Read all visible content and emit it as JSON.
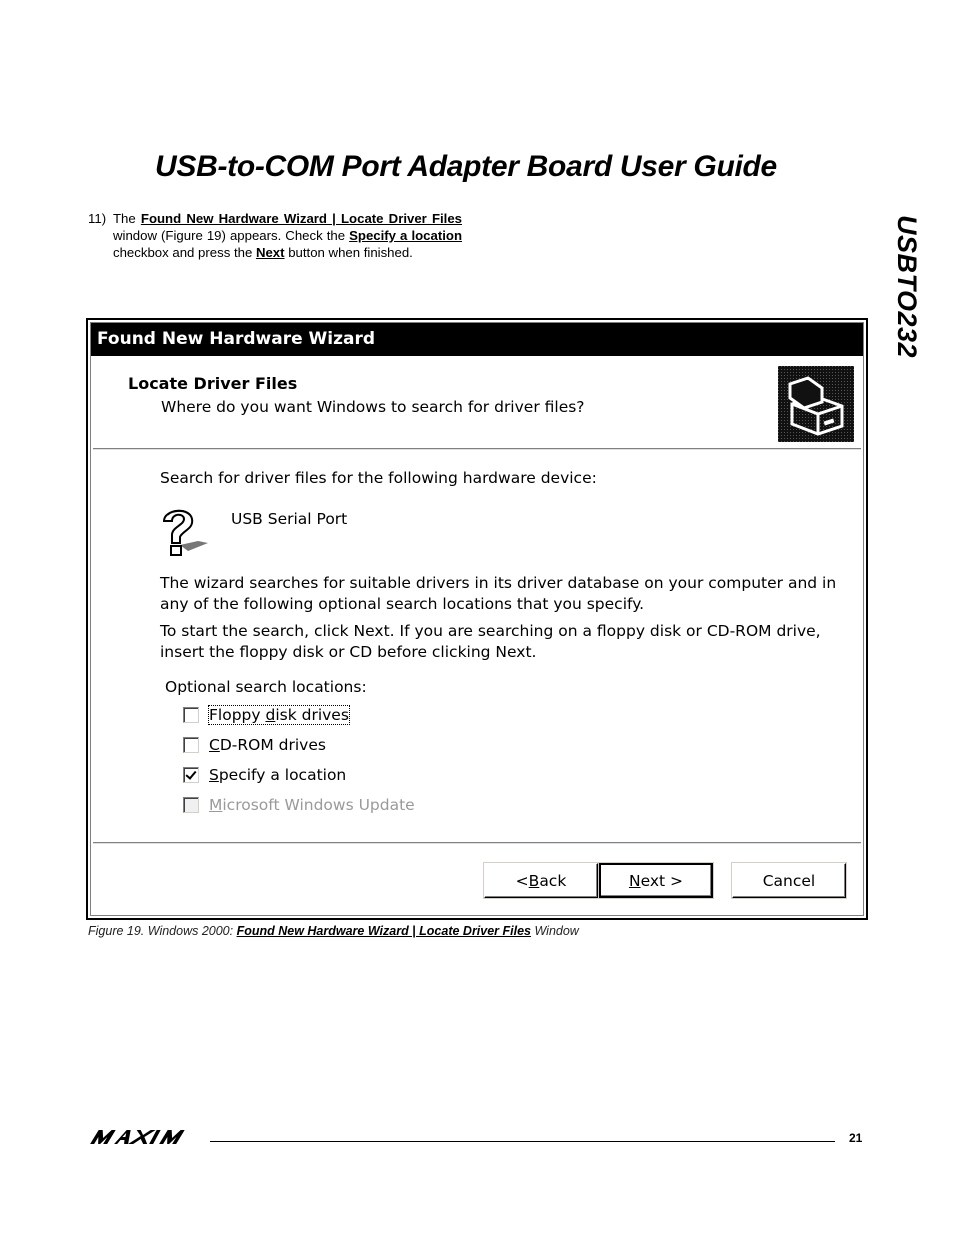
{
  "document": {
    "title": "USB-to-COM Port Adapter Board User Guide",
    "side_title": "USBTO232",
    "step": {
      "number": "11)",
      "parts": [
        "The ",
        "Found New Hardware Wizard | Locate Driver Files",
        " window (Figure 19) appears. Check the ",
        "Specify a location",
        " checkbox and press the ",
        "Next",
        " button when finished."
      ]
    },
    "caption": {
      "prefix": "Figure 19. Windows 2000: ",
      "bold": "Found New Hardware Wizard | Locate Driver Files",
      "suffix": " Window"
    },
    "footer": {
      "logo": "MAXIM",
      "page_number": "21"
    }
  },
  "window": {
    "title": "Found New Hardware Wizard",
    "header_title": "Locate Driver Files",
    "header_subtitle": "Where do you want Windows to search for driver files?",
    "header_icon": "hardware-card-icon",
    "intro": "Search for driver files for the following hardware device:",
    "device_icon": "unknown-device-question-icon",
    "device_name": "USB Serial Port",
    "paragraph1_line1": "The wizard searches for suitable drivers in its driver database on your computer and in",
    "paragraph1_line2": "any of the following optional search locations that you specify.",
    "paragraph2_line1": "To start the search, click Next. If you are searching on a floppy disk or CD-ROM drive,",
    "paragraph2_line2": "insert the floppy disk or CD before clicking Next.",
    "options_label": "Optional search locations:",
    "options": [
      {
        "pre": "Floppy ",
        "accel": "d",
        "post": "isk drives",
        "checked": false,
        "enabled": true,
        "focused": true
      },
      {
        "pre": "",
        "accel": "C",
        "post": "D-ROM drives",
        "checked": false,
        "enabled": true,
        "focused": false
      },
      {
        "pre": "",
        "accel": "S",
        "post": "pecify a location",
        "checked": true,
        "enabled": true,
        "focused": false
      },
      {
        "pre": "",
        "accel": "M",
        "post": "icrosoft Windows Update",
        "checked": false,
        "enabled": false,
        "focused": false
      }
    ],
    "buttons": {
      "back": {
        "pre": "< ",
        "accel": "B",
        "post": "ack"
      },
      "next": {
        "pre": "",
        "accel": "N",
        "post": "ext >"
      },
      "cancel": "Cancel"
    }
  }
}
